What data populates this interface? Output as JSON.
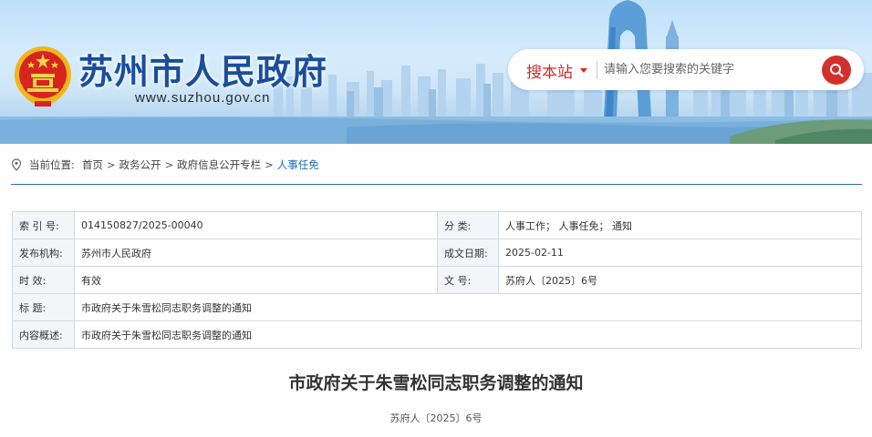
{
  "header": {
    "site_title": "苏州市人民政府",
    "site_url": "www.suzhou.gov.cn",
    "emblem_icon": "national-emblem-icon",
    "accent_color": "#1a4e9c"
  },
  "search": {
    "scope_label": "搜本站",
    "placeholder": "请输入您要搜索的关键字",
    "value": "",
    "button_color": "#d4302b"
  },
  "breadcrumb": {
    "label": "当前位置:",
    "items": [
      "首页",
      "政务公开",
      "政府信息公开专栏",
      "人事任免"
    ],
    "separator": ">"
  },
  "info": {
    "index_no_label": "索 引 号:",
    "index_no": "014150827/2025-00040",
    "category_label": "分      类:",
    "category": "人事工作；  人事任免；  通知",
    "publisher_label": "发布机构:",
    "publisher": "苏州市人民政府",
    "date_label": "成文日期:",
    "date": "2025-02-11",
    "validity_label": "时      效:",
    "validity": "有效",
    "doc_no_label": "文      号:",
    "doc_no": "苏府人〔2025〕6号",
    "title_label": "标      题:",
    "title": "市政府关于朱雪松同志职务调整的通知",
    "summary_label": "内容概述:",
    "summary": "市政府关于朱雪松同志职务调整的通知"
  },
  "article": {
    "title": "市政府关于朱雪松同志职务调整的通知",
    "doc_no": "苏府人〔2025〕6号"
  }
}
